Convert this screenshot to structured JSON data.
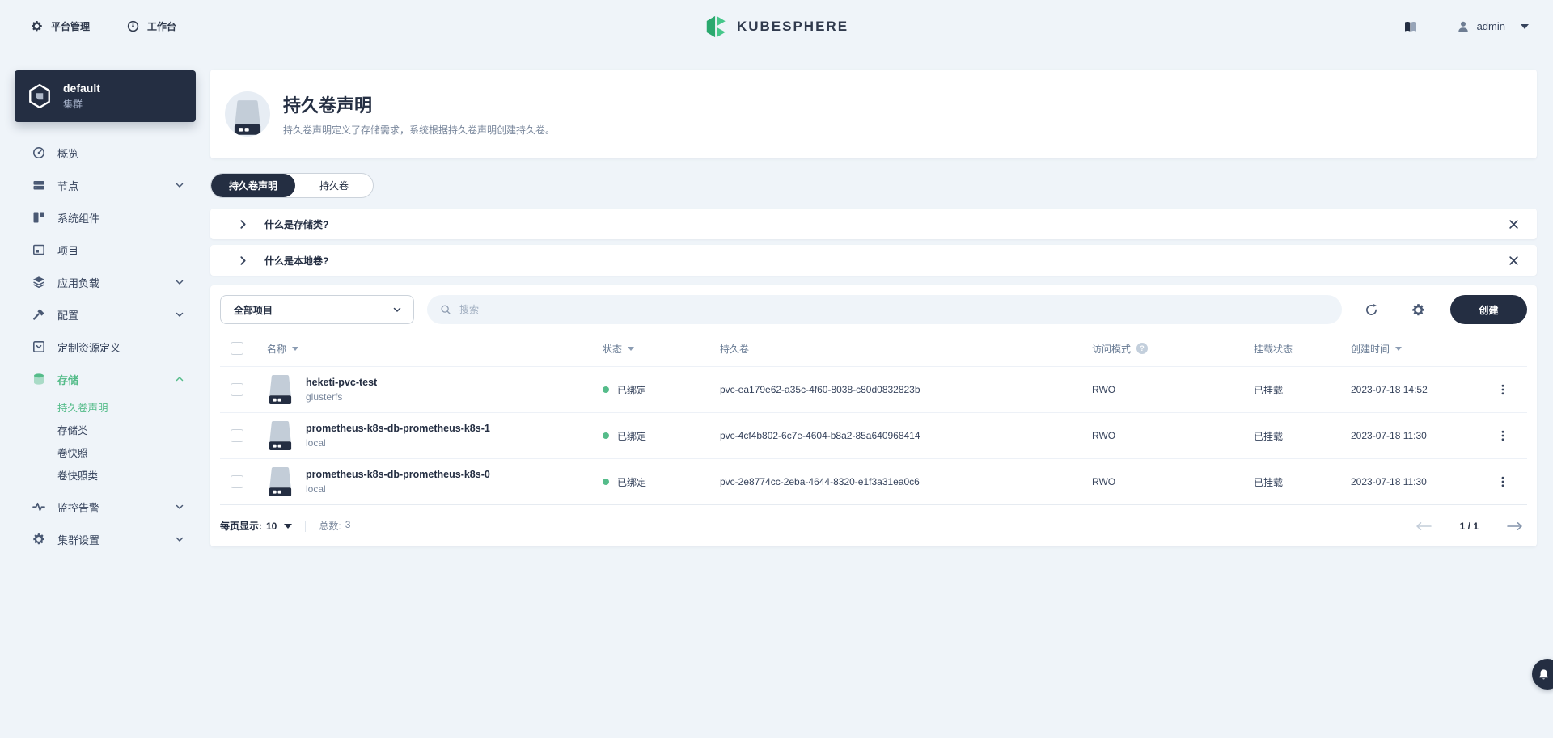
{
  "colors": {
    "page_bg": "#eff4f9",
    "brand_dark": "#242e42",
    "accent_green": "#55bc8a",
    "status_bound_green": "#55bc8a",
    "secondary_text": "#79879c"
  },
  "topbar": {
    "platform": "平台管理",
    "workbench": "工作台",
    "logo": "KUBESPHERE",
    "username": "admin"
  },
  "cluster": {
    "name": "default",
    "type": "集群"
  },
  "sidebar": {
    "items": [
      {
        "label": "概览"
      },
      {
        "label": "节点"
      },
      {
        "label": "系统组件"
      },
      {
        "label": "项目"
      },
      {
        "label": "应用负载"
      },
      {
        "label": "配置"
      },
      {
        "label": "定制资源定义"
      },
      {
        "label": "存储"
      },
      {
        "label": "监控告警"
      },
      {
        "label": "集群设置"
      }
    ],
    "storage_children": [
      {
        "label": "持久卷声明"
      },
      {
        "label": "存储类"
      },
      {
        "label": "卷快照"
      },
      {
        "label": "卷快照类"
      }
    ]
  },
  "page": {
    "title": "持久卷声明",
    "description": "持久卷声明定义了存储需求，系统根据持久卷声明创建持久卷。",
    "tab_pvc": "持久卷声明",
    "tab_pv": "持久卷",
    "banner_storageclass": "什么是存储类?",
    "banner_localvolume": "什么是本地卷?"
  },
  "toolbar": {
    "project_filter": "全部项目",
    "search_placeholder": "搜索",
    "create": "创建"
  },
  "table": {
    "headers": {
      "name": "名称",
      "status": "状态",
      "pv": "持久卷",
      "access": "访问模式",
      "mount": "挂载状态",
      "created": "创建时间"
    },
    "rows": [
      {
        "name": "heketi-pvc-test",
        "storage_class": "glusterfs",
        "status": "已绑定",
        "pv": "pvc-ea179e62-a35c-4f60-8038-c80d0832823b",
        "access": "RWO",
        "mount": "已挂载",
        "created": "2023-07-18 14:52"
      },
      {
        "name": "prometheus-k8s-db-prometheus-k8s-1",
        "storage_class": "local",
        "status": "已绑定",
        "pv": "pvc-4cf4b802-6c7e-4604-b8a2-85a640968414",
        "access": "RWO",
        "mount": "已挂载",
        "created": "2023-07-18 11:30"
      },
      {
        "name": "prometheus-k8s-db-prometheus-k8s-0",
        "storage_class": "local",
        "status": "已绑定",
        "pv": "pvc-2e8774cc-2eba-4644-8320-e1f3a31ea0c6",
        "access": "RWO",
        "mount": "已挂载",
        "created": "2023-07-18 11:30"
      }
    ]
  },
  "pagination": {
    "per_page_label": "每页显示:",
    "per_page": "10",
    "total_label": "总数:",
    "total": "3",
    "page": "1 / 1"
  }
}
